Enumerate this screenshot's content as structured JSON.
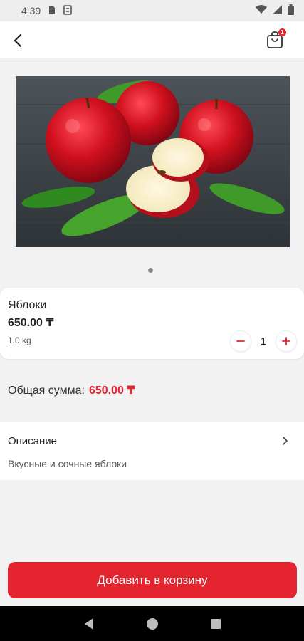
{
  "status_bar": {
    "time": "4:39",
    "icons": [
      "storage-icon",
      "sync-icon",
      "wifi-icon",
      "signal-icon",
      "battery-icon"
    ]
  },
  "app_bar": {
    "back_icon": "chevron-left-icon",
    "cart_icon": "shopping-bag-icon",
    "cart_count": "1"
  },
  "gallery": {
    "image": "red-apples-photo",
    "pages": 1,
    "active_page": 1
  },
  "product": {
    "name": "Яблоки",
    "price": "650.00 ₸",
    "weight": "1.0 kg",
    "quantity": "1",
    "minus_icon": "minus-icon",
    "plus_icon": "plus-icon"
  },
  "total": {
    "label": "Общая сумма:",
    "value": "650.00 ₸"
  },
  "description": {
    "title": "Описание",
    "text": "Вкусные и сочные яблоки"
  },
  "actions": {
    "add_to_cart_label": "Добавить в корзину"
  },
  "colors": {
    "accent": "#e4252f",
    "background": "#f2f2f2",
    "card": "#ffffff"
  }
}
